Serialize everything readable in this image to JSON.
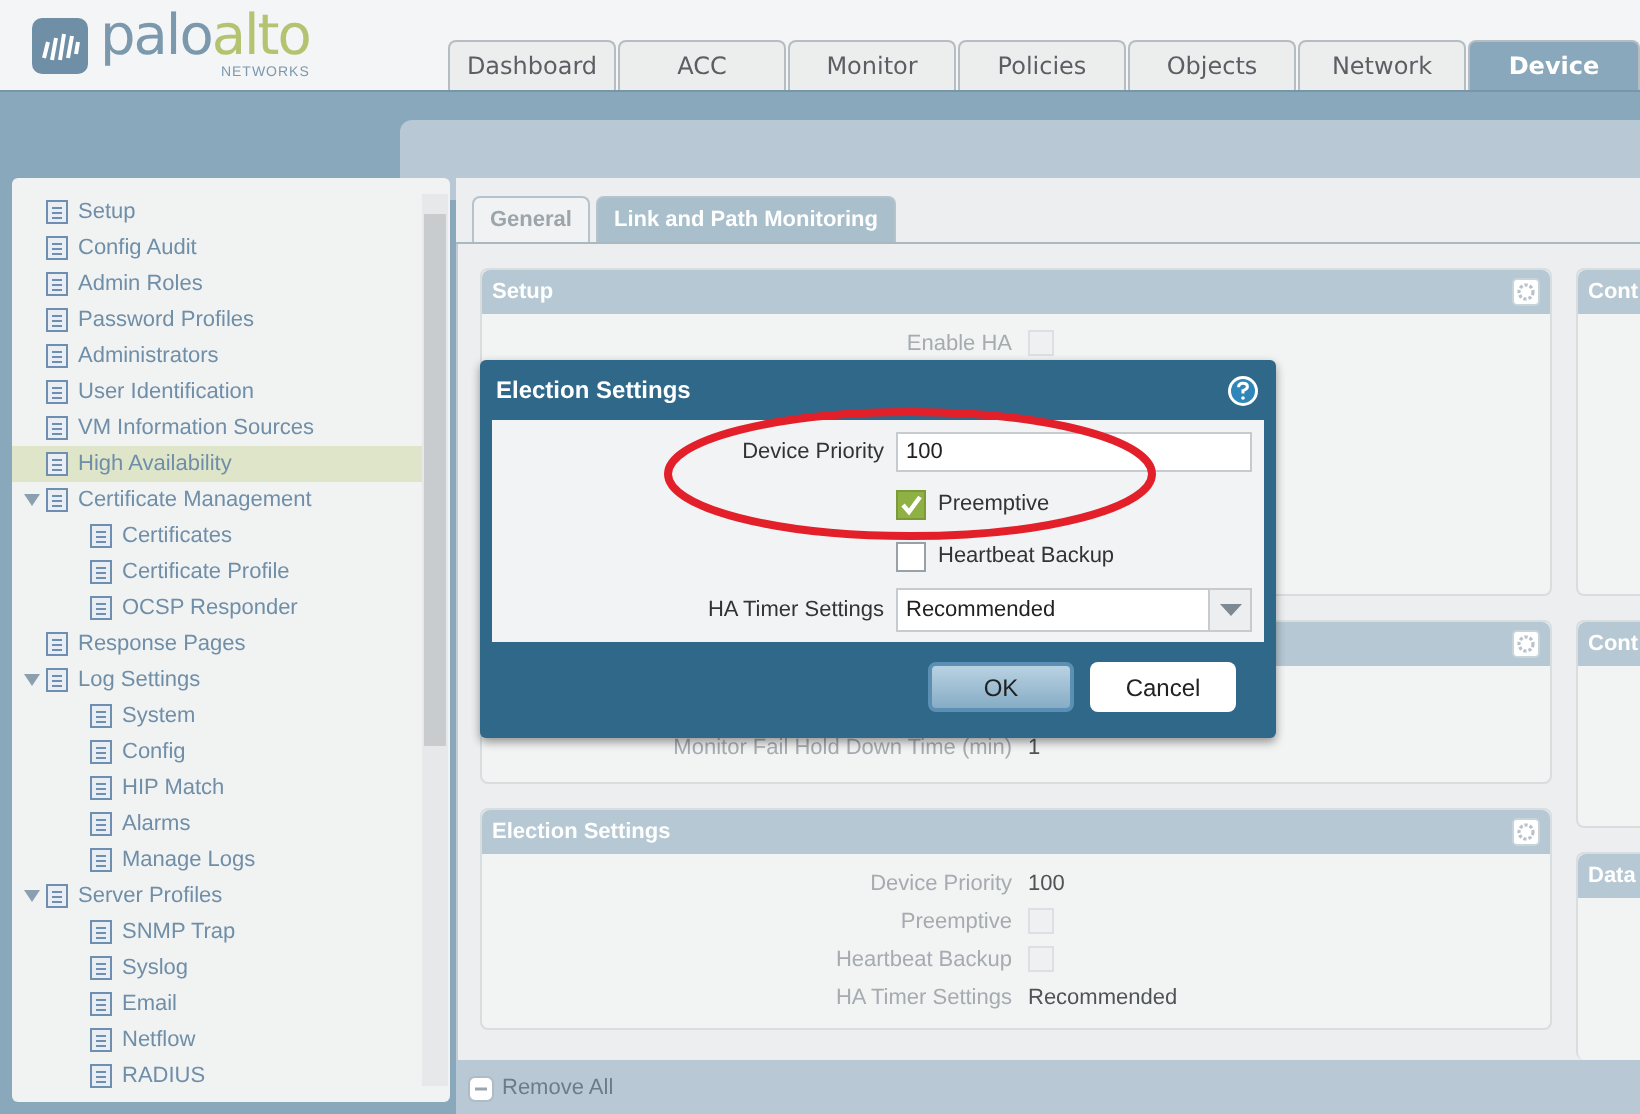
{
  "logo": {
    "part_1": "palo",
    "part_2": "alto",
    "tagline": "NETWORKS"
  },
  "tabs": [
    {
      "label": "Dashboard",
      "selected": false
    },
    {
      "label": "ACC",
      "selected": false
    },
    {
      "label": "Monitor",
      "selected": false
    },
    {
      "label": "Policies",
      "selected": false
    },
    {
      "label": "Objects",
      "selected": false
    },
    {
      "label": "Network",
      "selected": false
    },
    {
      "label": "Device",
      "selected": true
    }
  ],
  "sidebar": {
    "items": [
      {
        "label": "Setup",
        "selected": false
      },
      {
        "label": "Config Audit",
        "selected": false
      },
      {
        "label": "Admin Roles",
        "selected": false
      },
      {
        "label": "Password Profiles",
        "selected": false
      },
      {
        "label": "Administrators",
        "selected": false
      },
      {
        "label": "User Identification",
        "selected": false
      },
      {
        "label": "VM Information Sources",
        "selected": false
      },
      {
        "label": "High Availability",
        "selected": true
      },
      {
        "label": "Certificate Management",
        "selected": false,
        "expanded": true,
        "children": [
          {
            "label": "Certificates",
            "selected": false
          },
          {
            "label": "Certificate Profile",
            "selected": false
          },
          {
            "label": "OCSP Responder",
            "selected": false
          }
        ]
      },
      {
        "label": "Response Pages",
        "selected": false
      },
      {
        "label": "Log Settings",
        "selected": false,
        "expanded": true,
        "children": [
          {
            "label": "System",
            "selected": false
          },
          {
            "label": "Config",
            "selected": false
          },
          {
            "label": "HIP Match",
            "selected": false
          },
          {
            "label": "Alarms",
            "selected": false
          },
          {
            "label": "Manage Logs",
            "selected": false
          }
        ]
      },
      {
        "label": "Server Profiles",
        "selected": false,
        "expanded": true,
        "children": [
          {
            "label": "SNMP Trap",
            "selected": false
          },
          {
            "label": "Syslog",
            "selected": false
          },
          {
            "label": "Email",
            "selected": false
          },
          {
            "label": "Netflow",
            "selected": false
          },
          {
            "label": "RADIUS",
            "selected": false
          }
        ]
      }
    ]
  },
  "subtabs": [
    {
      "label": "General",
      "selected": true
    },
    {
      "label": "Link and Path Monitoring",
      "selected": false
    }
  ],
  "panels": [
    {
      "title": "Setup",
      "rows": [
        {
          "kind": "checkbox",
          "label": "Enable HA",
          "checked": false
        }
      ]
    },
    {
      "rows": [
        {
          "kind": "text",
          "label": "Monitor Fail Hold Down Time (min)",
          "value": "1"
        }
      ]
    },
    {
      "title": "Election Settings",
      "rows": [
        {
          "kind": "text",
          "label": "Device Priority",
          "value": "100"
        },
        {
          "kind": "checkbox",
          "label": "Preemptive",
          "checked": false
        },
        {
          "kind": "checkbox",
          "label": "Heartbeat Backup",
          "checked": false
        },
        {
          "kind": "text",
          "label": "HA Timer Settings",
          "value": "Recommended"
        }
      ]
    }
  ],
  "right_panels": [
    {
      "title": "Cont"
    },
    {
      "title": "Cont"
    },
    {
      "title": "Data"
    }
  ],
  "footer": {
    "remove_all": "Remove All"
  },
  "dialog": {
    "title": "Election Settings",
    "fields": [
      {
        "kind": "input",
        "label": "Device Priority",
        "value": "100"
      },
      {
        "kind": "checkbox",
        "label": "Preemptive",
        "checked": true
      },
      {
        "kind": "checkbox",
        "label": "Heartbeat Backup",
        "checked": false
      },
      {
        "kind": "select",
        "label": "HA Timer Settings",
        "value": "Recommended"
      }
    ],
    "buttons": [
      {
        "label": "OK",
        "kind": "primary"
      },
      {
        "label": "Cancel",
        "kind": "secondary"
      }
    ]
  }
}
